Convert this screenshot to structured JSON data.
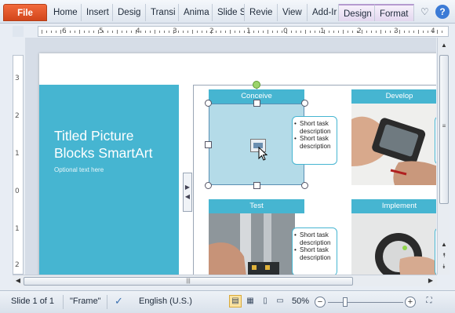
{
  "ribbon": {
    "file_label": "File",
    "tabs": [
      "Home",
      "Insert",
      "Desig",
      "Transi",
      "Anima",
      "Slide S",
      "Revie",
      "View",
      "Add-Ir"
    ],
    "context_tabs": [
      "Design",
      "Format"
    ],
    "help_label": "?"
  },
  "ruler": {
    "h_numbers": [
      "6",
      "5",
      "4",
      "3",
      "2",
      "1",
      "0",
      "1",
      "2",
      "3",
      "4"
    ],
    "v_numbers": [
      "3",
      "2",
      "1",
      "0",
      "1",
      "2"
    ]
  },
  "slide": {
    "title": "Titled Picture Blocks SmartArt",
    "subtitle": "Optional text here",
    "blocks": [
      {
        "label": "Conceive",
        "bullets": [
          "Short task description",
          "Short task description"
        ]
      },
      {
        "label": "Develop",
        "bullets": []
      },
      {
        "label": "Test",
        "bullets": [
          "Short task description",
          "Short task description"
        ]
      },
      {
        "label": "Implement",
        "bullets": []
      }
    ]
  },
  "statusbar": {
    "slide_info": "Slide 1 of 1",
    "theme": "\"Frame\"",
    "language": "English (U.S.)",
    "zoom": "50%",
    "zoom_out": "−",
    "zoom_in": "+"
  },
  "colors": {
    "accent": "#46b5d1",
    "file_tab": "#d2461b"
  },
  "icons": [
    "heart-icon",
    "help-icon",
    "spellcheck-icon",
    "normal-view-icon",
    "slide-sorter-icon",
    "reading-view-icon",
    "slideshow-icon",
    "fit-slide-icon",
    "picture-placeholder-icon"
  ]
}
